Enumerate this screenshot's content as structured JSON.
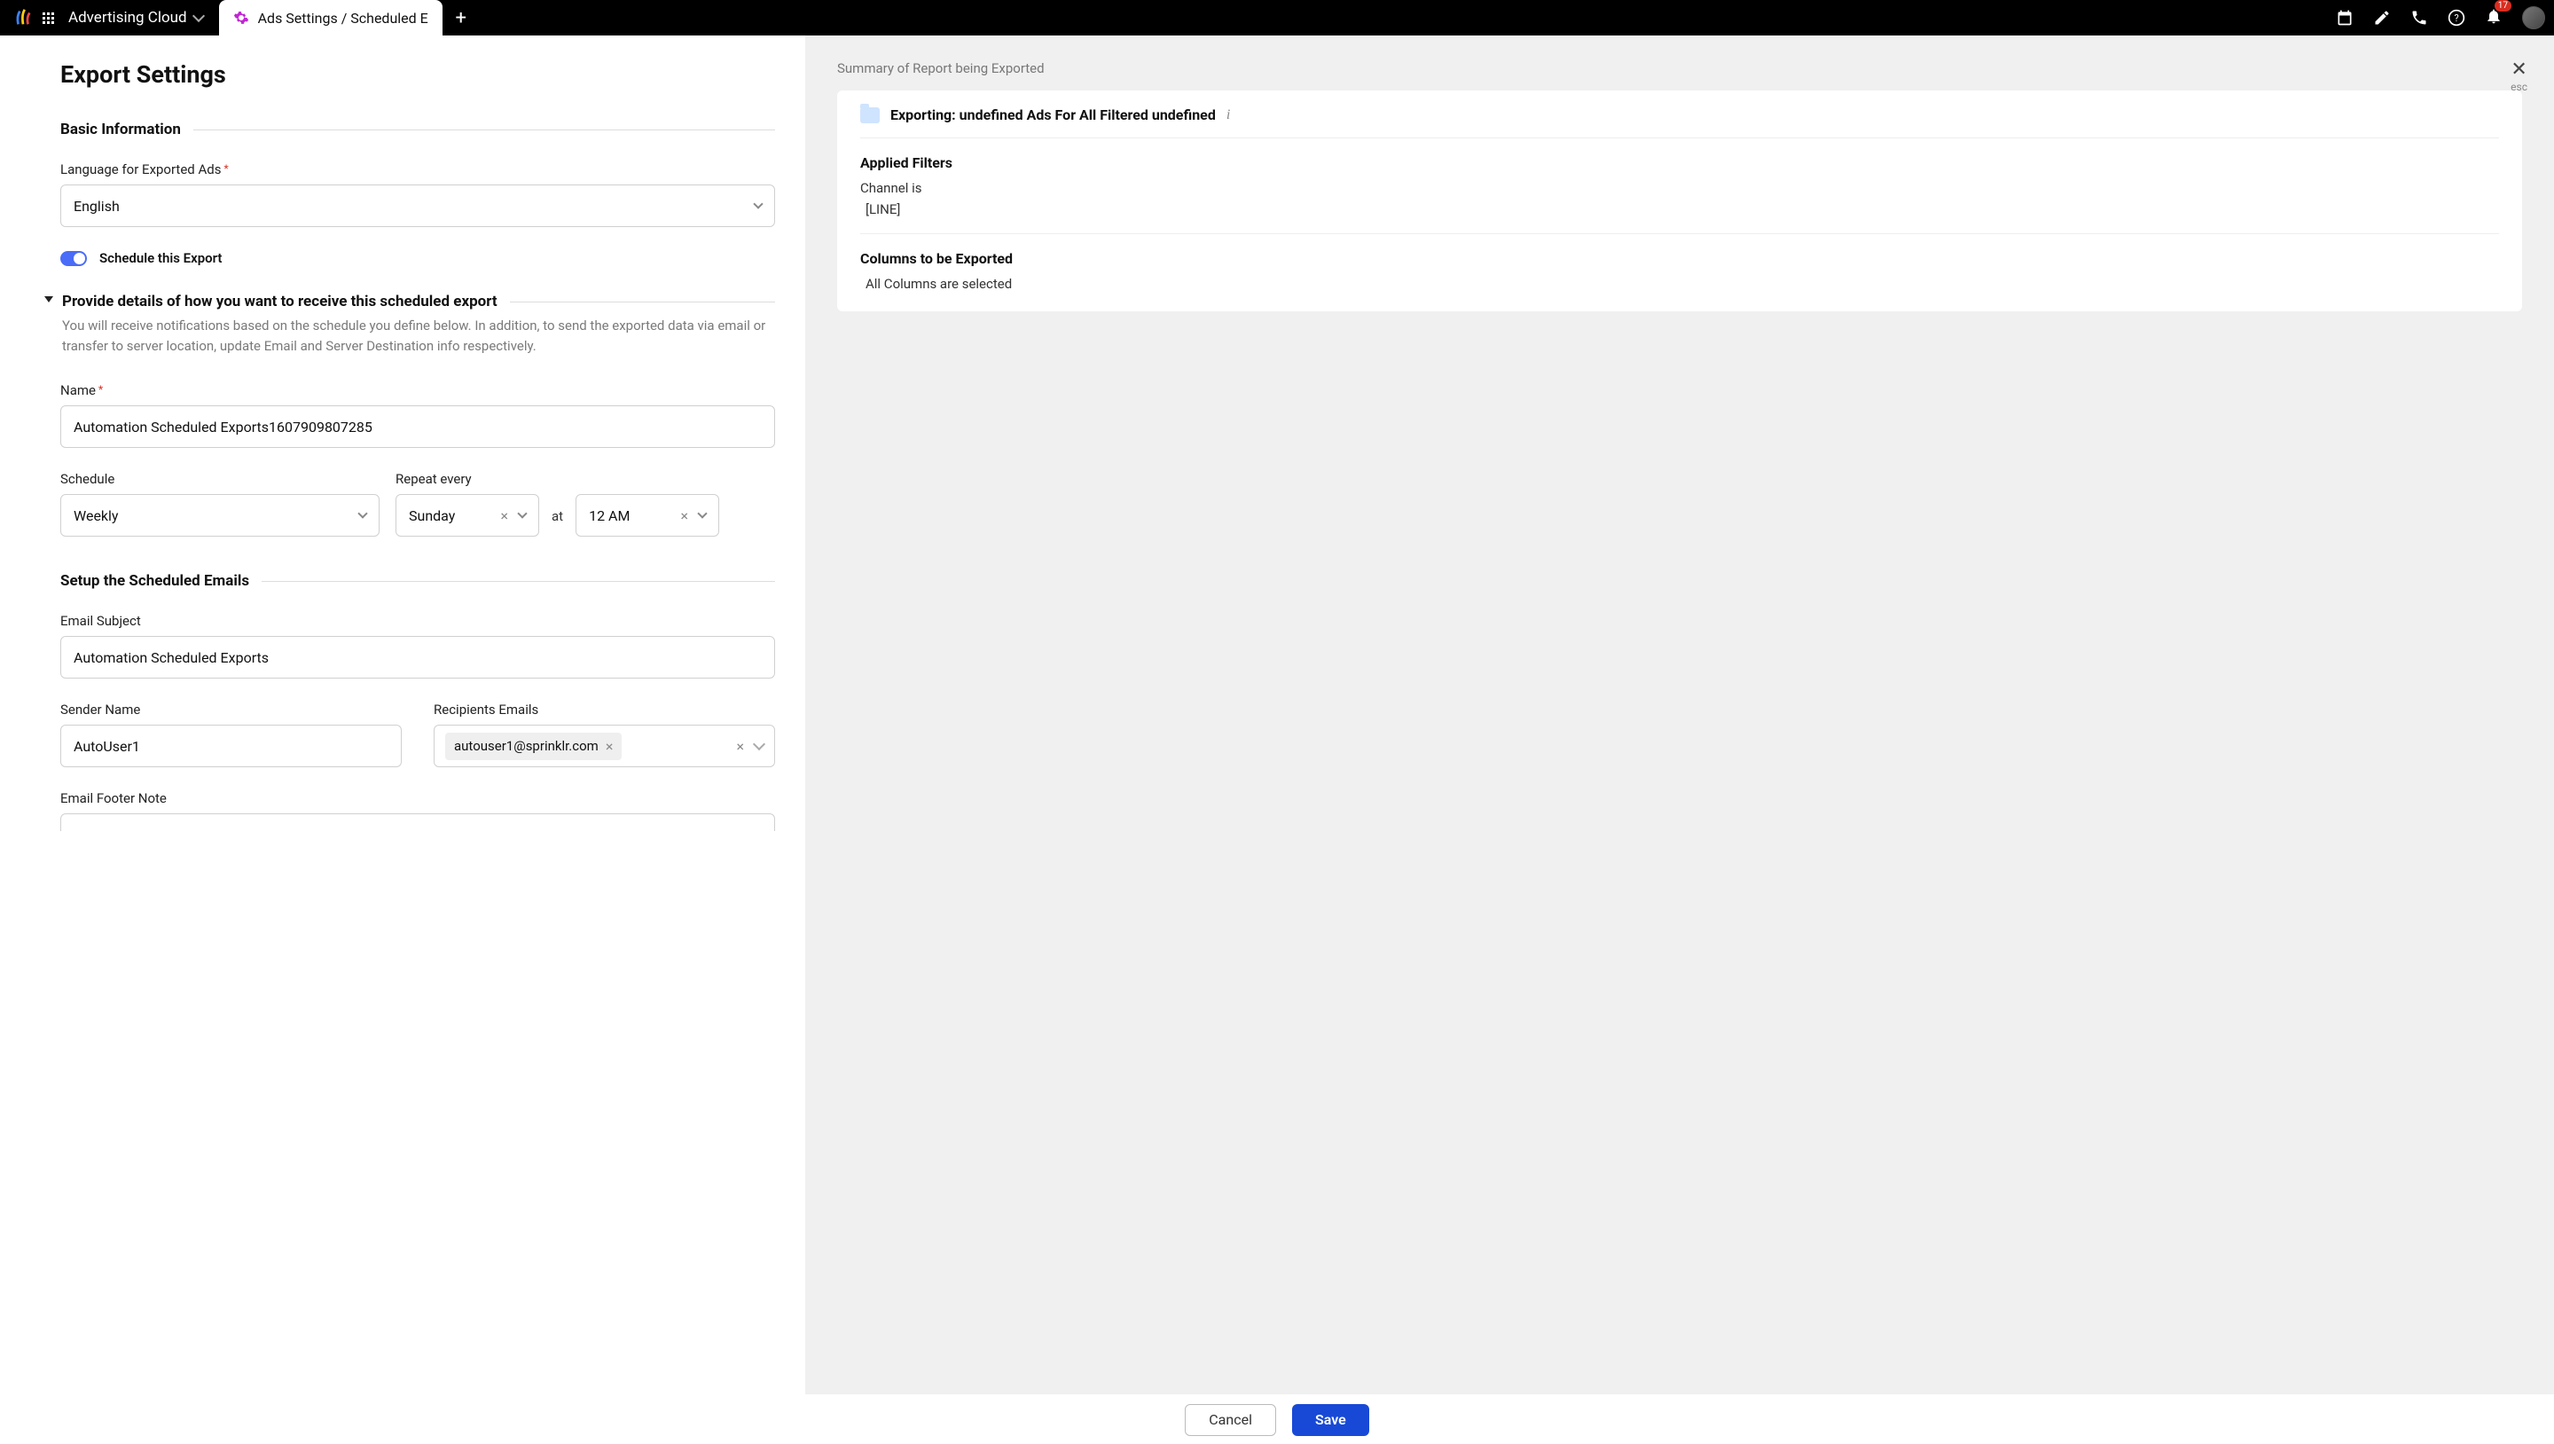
{
  "topbar": {
    "app": "Advertising Cloud",
    "tab": "Ads Settings / Scheduled E",
    "notif_count": "17"
  },
  "page": {
    "title": "Export Settings",
    "section_basic": "Basic Information",
    "lang_label": "Language for Exported Ads",
    "lang_value": "English",
    "schedule_toggle": "Schedule this Export",
    "details_title": "Provide details of how you want to receive this scheduled export",
    "details_help": "You will receive notifications based on the schedule you define below. In addition, to send the exported data via email or transfer to server location, update Email and Server Destination info respectively.",
    "name_label": "Name",
    "name_value": "Automation Scheduled Exports1607909807285",
    "schedule_label": "Schedule",
    "schedule_value": "Weekly",
    "repeat_label": "Repeat every",
    "repeat_day": "Sunday",
    "at": "at",
    "repeat_time": "12 AM",
    "section_emails": "Setup the Scheduled Emails",
    "email_subject_label": "Email Subject",
    "email_subject_value": "Automation Scheduled Exports",
    "sender_label": "Sender Name",
    "sender_value": "AutoUser1",
    "recip_label": "Recipients Emails",
    "recip_value": "autouser1@sprinklr.com",
    "footer_label": "Email Footer Note"
  },
  "summary": {
    "title": "Summary of Report being Exported",
    "close": "esc",
    "export_title": "Exporting: undefined Ads For All Filtered undefined",
    "filters_title": "Applied Filters",
    "filter_key": "Channel is",
    "filter_val": "[LINE]",
    "columns_title": "Columns to be Exported",
    "columns_val": "All Columns are selected"
  },
  "footer": {
    "cancel": "Cancel",
    "save": "Save"
  }
}
